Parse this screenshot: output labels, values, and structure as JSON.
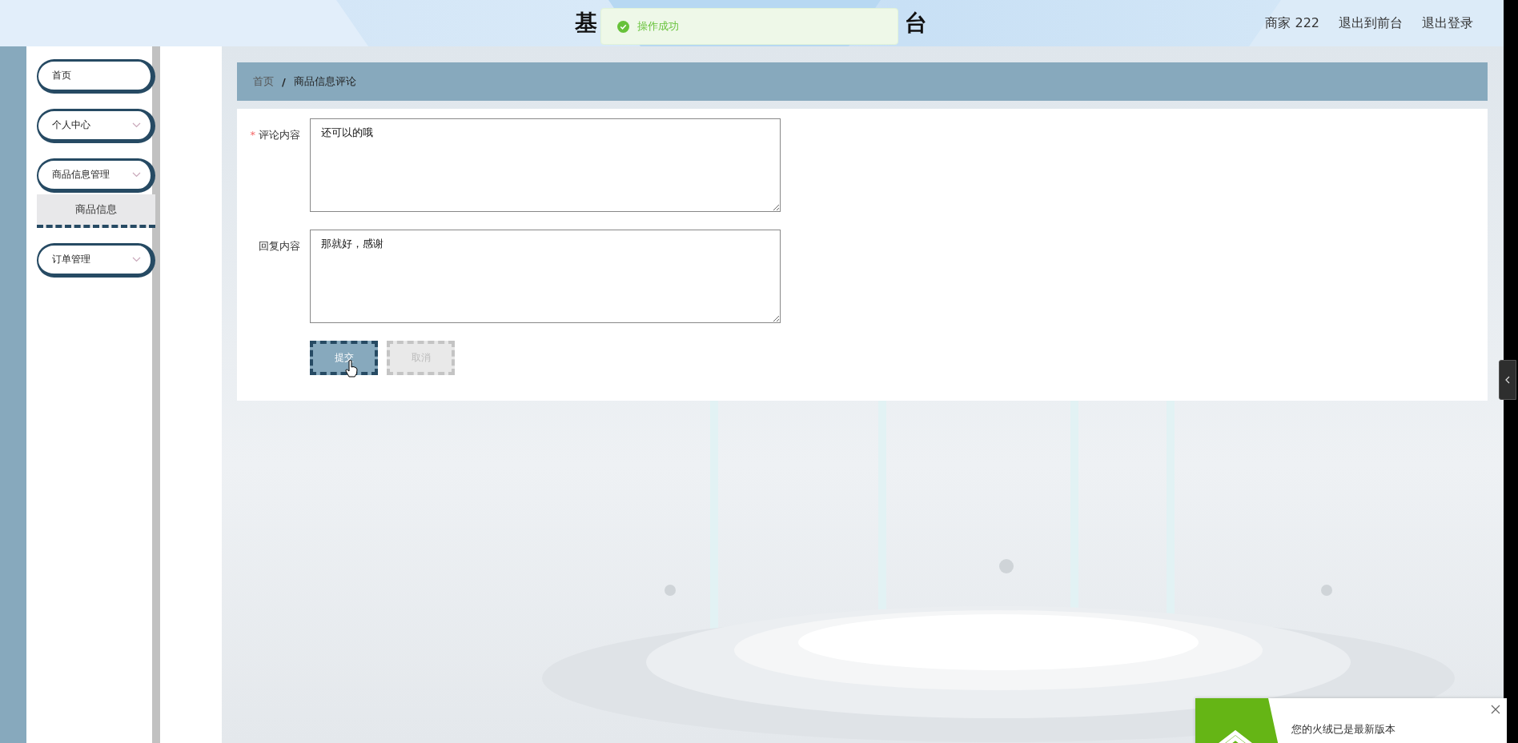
{
  "header": {
    "title_parts": [
      "基",
      "台"
    ],
    "user": "商家 222",
    "links": [
      "退出到前台",
      "退出登录"
    ]
  },
  "toast": {
    "message": "操作成功"
  },
  "sidebar": {
    "items": [
      {
        "label": "首页",
        "kind": "link"
      },
      {
        "label": "个人中心",
        "kind": "menu"
      },
      {
        "label": "商品信息管理",
        "kind": "menu",
        "children": [
          {
            "label": "商品信息"
          }
        ]
      },
      {
        "label": "订单管理",
        "kind": "menu"
      }
    ]
  },
  "breadcrumb": {
    "home": "首页",
    "separator": "/",
    "current": "商品信息评论"
  },
  "form": {
    "required_mark": "*",
    "fields": [
      {
        "label": "评论内容",
        "required": true,
        "value": "还可以的哦"
      },
      {
        "label": "回复内容",
        "required": false,
        "value": "那就好，感谢"
      }
    ],
    "buttons": [
      {
        "label": "提交",
        "kind": "primary"
      },
      {
        "label": "取消",
        "kind": "secondary"
      }
    ]
  },
  "notification": {
    "message": "您的火绒已是最新版本"
  }
}
